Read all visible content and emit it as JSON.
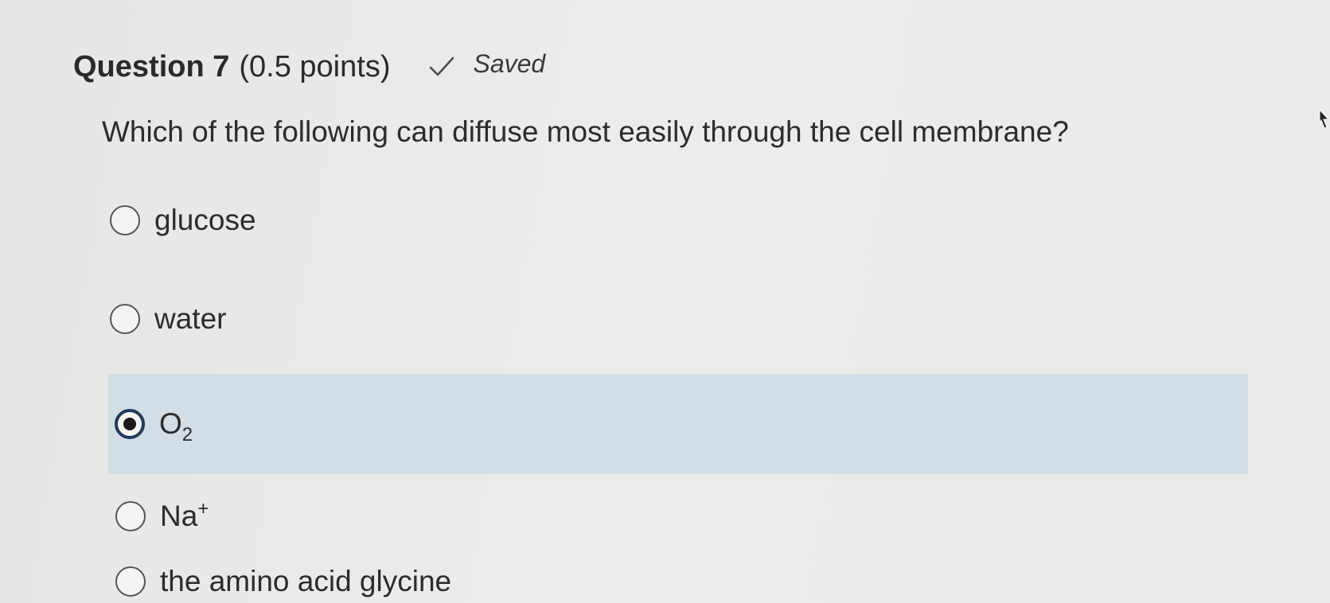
{
  "question": {
    "title": "Question 7",
    "points": "(0.5 points)",
    "status_icon": "checkmark-icon",
    "status": "Saved",
    "prompt": "Which of the following can diffuse most easily through the cell membrane?"
  },
  "options": [
    {
      "label": "glucose",
      "selected": false
    },
    {
      "label": "water",
      "selected": false
    },
    {
      "label_base": "O",
      "label_sub": "2",
      "selected": true
    },
    {
      "label_base": "Na",
      "label_sup": "+",
      "selected": false
    },
    {
      "label": "the amino acid glycine",
      "selected": false
    }
  ],
  "colors": {
    "background": "#e9e9e7",
    "selected_row": "#d3dde6",
    "selected_radio_ring": "#1f3a5a"
  }
}
